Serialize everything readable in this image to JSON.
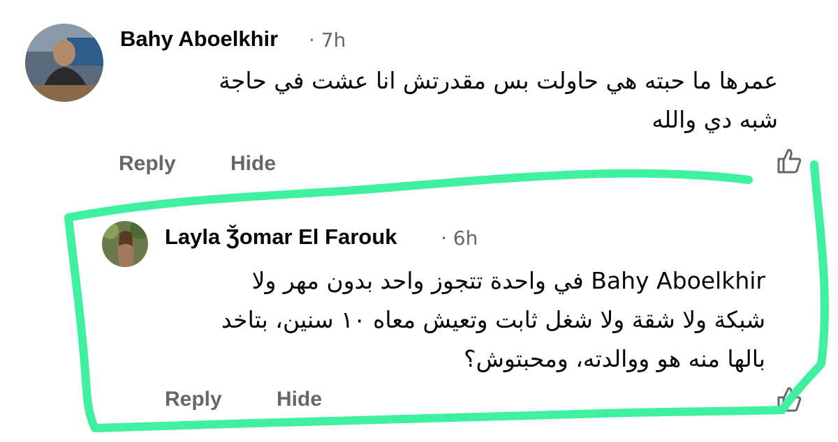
{
  "comments": [
    {
      "author": "Bahy Aboelkhir",
      "time": "· 7h",
      "lines": [
        "عمرها ما حبته هي حاولت بس مقدرتش انا عشت في حاجة",
        "شبه دي والله"
      ],
      "reply_label": "Reply",
      "hide_label": "Hide",
      "like_icon": "thumbs-up-icon"
    },
    {
      "author": "Layla Ǯomar El Farouk",
      "time": "· 6h",
      "lines": [
        "Bahy Aboelkhir في واحدة تتجوز واحد بدون مهر ولا",
        "شبكة ولا شقة ولا شغل ثابت وتعيش معاه ١٠ سنين، بتاخد",
        "بالها منه هو ووالدته، ومحبتوش؟"
      ],
      "reply_label": "Reply",
      "hide_label": "Hide",
      "like_icon": "thumbs-up-icon"
    }
  ],
  "colors": {
    "text": "#050505",
    "secondary": "#65676b",
    "highlight": "#3ef0a0"
  }
}
